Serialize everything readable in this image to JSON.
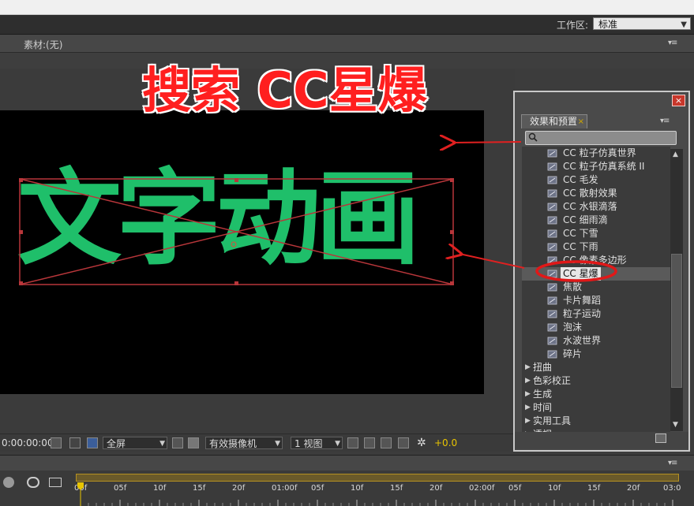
{
  "workspace": {
    "label": "工作区:",
    "value": "标准"
  },
  "source_panel": {
    "label": "素材:(无)"
  },
  "headline": "搜索 CC星爆",
  "composition": {
    "text": "文字动画"
  },
  "viewer_toolbar": {
    "timecode": "0:00:00:00",
    "zoom": "全屏",
    "camera": "有效摄像机",
    "views": "1 视图",
    "exposure": "+0.0"
  },
  "timeline": {
    "ticks": [
      "00f",
      "05f",
      "10f",
      "15f",
      "20f",
      "01:00f",
      "05f",
      "10f",
      "15f",
      "20f",
      "02:00f",
      "05f",
      "10f",
      "15f",
      "20f",
      "03:0"
    ]
  },
  "effects_panel": {
    "tab": "效果和预置",
    "search_value": "",
    "items": [
      {
        "kind": "child",
        "label": "CC 粒子仿真世界"
      },
      {
        "kind": "child",
        "label": "CC 粒子仿真系统 II"
      },
      {
        "kind": "child",
        "label": "CC 毛发"
      },
      {
        "kind": "child",
        "label": "CC 散射效果"
      },
      {
        "kind": "child",
        "label": "CC 水银滴落"
      },
      {
        "kind": "child",
        "label": "CC 细雨滴"
      },
      {
        "kind": "child",
        "label": "CC 下雪"
      },
      {
        "kind": "child",
        "label": "CC 下雨"
      },
      {
        "kind": "child",
        "label": "CC 像素多边形"
      },
      {
        "kind": "child",
        "label": "CC 星爆",
        "selected": true
      },
      {
        "kind": "child",
        "label": "焦散"
      },
      {
        "kind": "child",
        "label": "卡片舞蹈"
      },
      {
        "kind": "child",
        "label": "粒子运动"
      },
      {
        "kind": "child",
        "label": "泡沫"
      },
      {
        "kind": "child",
        "label": "水波世界"
      },
      {
        "kind": "child",
        "label": "碎片"
      },
      {
        "kind": "cat",
        "label": "扭曲"
      },
      {
        "kind": "cat",
        "label": "色彩校正"
      },
      {
        "kind": "cat",
        "label": "生成"
      },
      {
        "kind": "cat",
        "label": "时间"
      },
      {
        "kind": "cat",
        "label": "实用工具"
      },
      {
        "kind": "cat",
        "label": "透视"
      }
    ]
  },
  "colors": {
    "text_green": "#1fbf6a",
    "annotation_red": "#ff1f1f",
    "exposure_yellow": "#e8c400"
  }
}
